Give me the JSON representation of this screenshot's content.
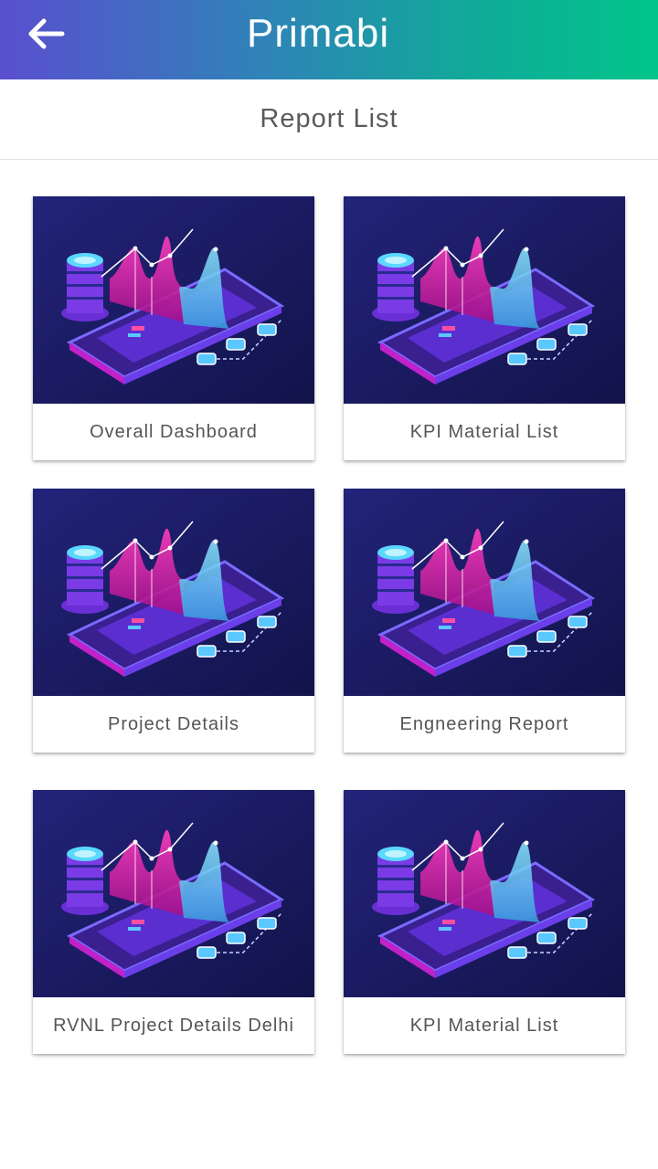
{
  "header": {
    "logo_text": "Primabi",
    "gradient_start": "#5a4fcf",
    "gradient_end": "#00c58a"
  },
  "page": {
    "title": "Report List"
  },
  "reports": [
    {
      "label": "Overall Dashboard"
    },
    {
      "label": "KPI Material List"
    },
    {
      "label": "Project Details"
    },
    {
      "label": "Engneering Report"
    },
    {
      "label": "RVNL Project Details Delhi"
    },
    {
      "label": "KPI Material List"
    }
  ]
}
